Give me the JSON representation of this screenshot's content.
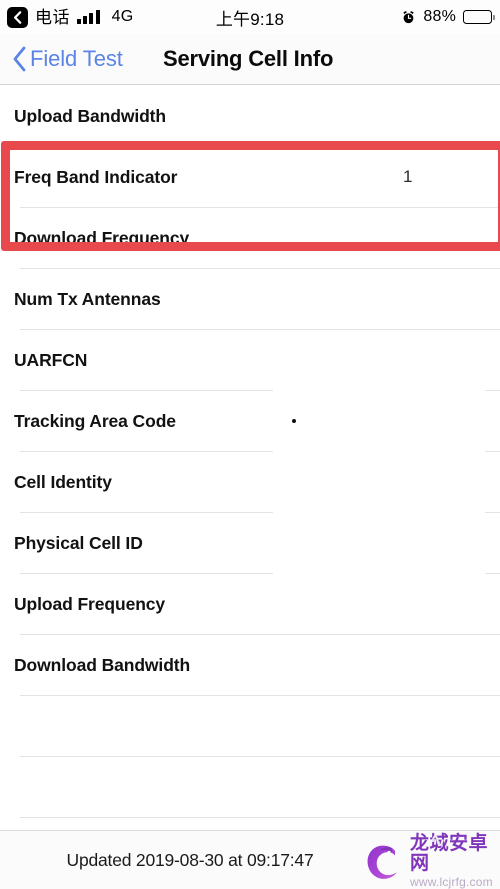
{
  "status_bar": {
    "back_icon": "back-chevron-badge-icon",
    "carrier": "电话",
    "signal_icon": "signal-bars-icon",
    "network_type": "4G",
    "time": "上午9:18",
    "alarm_icon": "alarm-clock-icon",
    "battery_percent": "88%",
    "battery_icon": "battery-icon"
  },
  "nav_bar": {
    "back_icon": "chevron-left-icon",
    "back_label": "Field Test",
    "title": "Serving Cell Info",
    "accent_color": "#5b84e6"
  },
  "list": {
    "rows": [
      {
        "label": "Upload Bandwidth",
        "value": "",
        "sep": "split"
      },
      {
        "label": "Freq Band Indicator",
        "value": "1",
        "sep": "full"
      },
      {
        "label": "Download Frequency",
        "value": "",
        "sep": "full"
      },
      {
        "label": "Num Tx Antennas",
        "value": "",
        "sep": "full"
      },
      {
        "label": "UARFCN",
        "value": "",
        "sep": "split"
      },
      {
        "label": "Tracking Area Code",
        "value": "",
        "sep": "split",
        "dot": true
      },
      {
        "label": "Cell Identity",
        "value": "",
        "sep": "split"
      },
      {
        "label": "Physical Cell ID",
        "value": "",
        "sep": "split"
      },
      {
        "label": "Upload Frequency",
        "value": "",
        "sep": "full"
      },
      {
        "label": "Download Bandwidth",
        "value": "",
        "sep": "full"
      },
      {
        "label": "",
        "value": "",
        "sep": "full"
      },
      {
        "label": "",
        "value": "",
        "sep": "full"
      }
    ]
  },
  "highlight": {
    "color": "#e8494c",
    "covers": [
      "Freq Band Indicator",
      "Download Frequency"
    ]
  },
  "footer": {
    "updated_text": "Updated 2019-08-30 at 09:17:47"
  },
  "watermark": {
    "logo_icon": "dragon-c-logo-icon",
    "site_name": "龙城安卓网",
    "site_url": "www.lcjrfg.com",
    "brand_color": "#7d2fb8"
  }
}
